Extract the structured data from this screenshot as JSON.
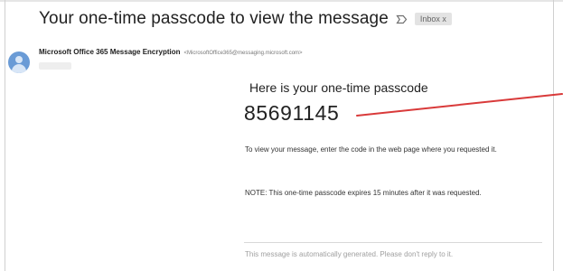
{
  "email": {
    "subject": "Your one-time passcode to view the message",
    "label_badge": "Inbox x",
    "sender": {
      "name": "Microsoft Office 365 Message Encryption",
      "address": "<MicrosoftOffice365@messaging.microsoft.com>"
    },
    "body": {
      "headline": "Here is your one-time passcode",
      "passcode": "85691145",
      "instruction": "To view your message, enter the code in the web page where you requested it.",
      "note": "NOTE: This one-time passcode expires 15 minutes after it was requested.",
      "footer": "This message is automatically generated. Please don't reply to it."
    }
  },
  "icons": {
    "importance": "importance-marker-icon",
    "avatar": "avatar-icon"
  },
  "colors": {
    "annotation_arrow": "#d93a3a",
    "avatar": "#6a9bd6"
  }
}
